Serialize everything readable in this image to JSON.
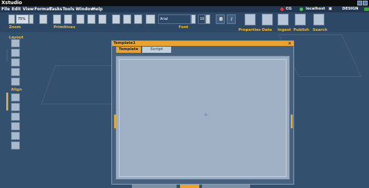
{
  "app": {
    "title": "Xstudio"
  },
  "menu": [
    "File",
    "Edit",
    "View",
    "Format",
    "Tasks",
    "Tools",
    "Window",
    "Help"
  ],
  "status": {
    "cg": "CG",
    "host": "localhost",
    "mode": "DESIGN"
  },
  "toolbar": {
    "zoom_label": "Zoom",
    "zoom_value": "75%",
    "primitives_label": "Primitives",
    "font_label": "Font",
    "font_value": "Arial",
    "size_value": "10",
    "bold": "B",
    "italic": "I",
    "right_buttons": [
      "Properties",
      "Data",
      "Ingest",
      "Publish",
      "Search"
    ]
  },
  "sidebar": {
    "layout_label": "Layout",
    "align_label": "Align"
  },
  "document": {
    "title": "Template1",
    "tabs": [
      "Template",
      "Script"
    ],
    "close": "×"
  },
  "colors": {
    "accent": "#f1bb3a",
    "background": "#34506f",
    "titlebar": "#e9a333"
  }
}
